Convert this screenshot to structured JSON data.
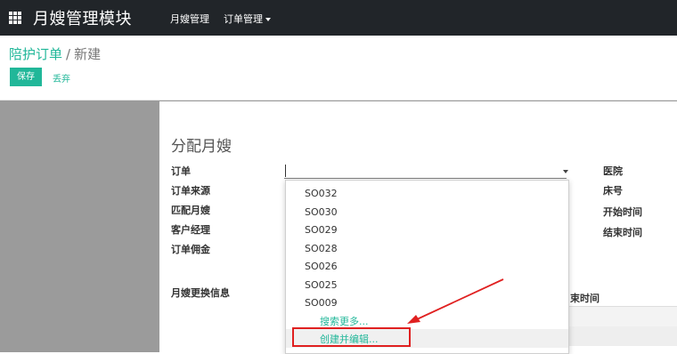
{
  "topbar": {
    "brand": "月嫂管理模块",
    "menu_items": [
      "月嫂管理",
      "订单管理"
    ]
  },
  "breadcrumb": {
    "parent": "陪护订单",
    "separator": "/",
    "current": "新建"
  },
  "buttons": {
    "save": "保存",
    "discard": "丢弃"
  },
  "form": {
    "title": "分配月嫂",
    "left_labels": [
      "订单",
      "订单来源",
      "匹配月嫂",
      "客户经理",
      "订单佣金"
    ],
    "right_labels": [
      "医院",
      "床号",
      "开始时间",
      "结束时间"
    ],
    "section_label": "月嫂更换信息",
    "table_header_partial": "束时间"
  },
  "dropdown": {
    "items": [
      "SO032",
      "SO030",
      "SO029",
      "SO028",
      "SO026",
      "SO025",
      "SO009"
    ],
    "search_more": "搜索更多...",
    "create_and_edit": "创建并编辑..."
  },
  "colors": {
    "accent": "#21b799",
    "topbar": "#212529",
    "annotation": "#e02020"
  }
}
